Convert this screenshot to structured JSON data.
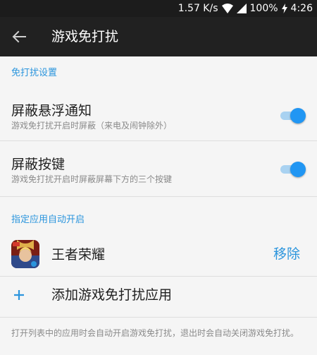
{
  "status_bar": {
    "net_speed": "1.57 K/s",
    "battery": "100%",
    "time": "4:26"
  },
  "toolbar": {
    "title": "游戏免打扰"
  },
  "section_dnd": {
    "header": "免打扰设置",
    "items": [
      {
        "title": "屏蔽悬浮通知",
        "subtitle": "游戏免打扰开启时屏蔽（来电及闹钟除外）",
        "enabled": true
      },
      {
        "title": "屏蔽按键",
        "subtitle": "游戏免打扰开启时屏蔽屏幕下方的三个按键",
        "enabled": true
      }
    ]
  },
  "section_apps": {
    "header": "指定应用自动开启",
    "apps": [
      {
        "name": "王者荣耀",
        "remove_label": "移除"
      }
    ],
    "add_label": "添加游戏免打扰应用"
  },
  "footer_note": "打开列表中的应用时会自动开启游戏免打扰，退出时会自动关闭游戏免打扰。",
  "colors": {
    "accent": "#2196f3",
    "accent_text": "#2b95dd",
    "toolbar_bg": "#212121",
    "background": "#f5f5f5"
  }
}
